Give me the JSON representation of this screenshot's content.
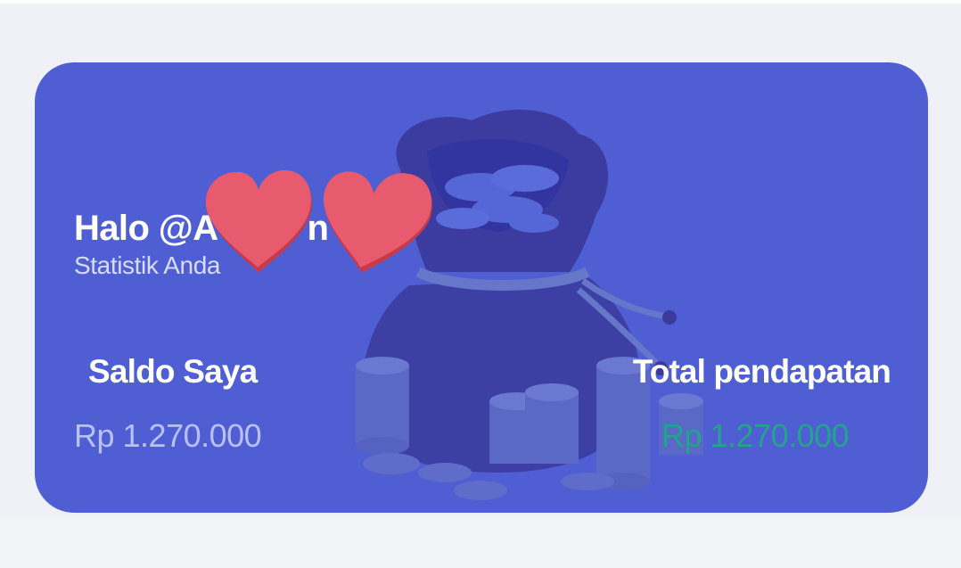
{
  "greeting": "Halo @A",
  "greeting_trail": "n",
  "subtitle": "Statistik Anda",
  "balance": {
    "label": "Saldo Saya",
    "value": "Rp 1.270.000"
  },
  "income": {
    "label": "Total pendapatan",
    "value": "Rp 1.270.000"
  },
  "colors": {
    "card": "#4f5fd3",
    "income_value": "#22a38b",
    "balance_value": "#b8c0f5",
    "sticker": "#e85a6e"
  },
  "icons": {
    "card_illustration": "money-bag-coins-illustration",
    "sticker": "heart-icon"
  }
}
